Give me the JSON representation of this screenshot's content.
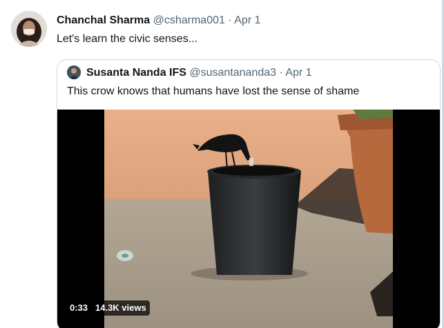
{
  "tweet": {
    "author_name": "Chanchal Sharma",
    "author_handle": "@csharma001",
    "separator": "·",
    "date": "Apr 1",
    "text": "Let's learn the civic senses..."
  },
  "quoted_tweet": {
    "author_name": "Susanta Nanda IFS",
    "author_handle": "@susantananda3",
    "separator": "·",
    "date": "Apr 1",
    "text": "This crow knows that humans have lost the sense of shame",
    "media": {
      "type": "video",
      "duration": "0:33",
      "views": "14.3K views"
    }
  },
  "colors": {
    "name": "#0f1419",
    "secondary": "#536471",
    "border": "#cfd9de",
    "badge_bg": "rgba(0,0,0,0.72)"
  }
}
